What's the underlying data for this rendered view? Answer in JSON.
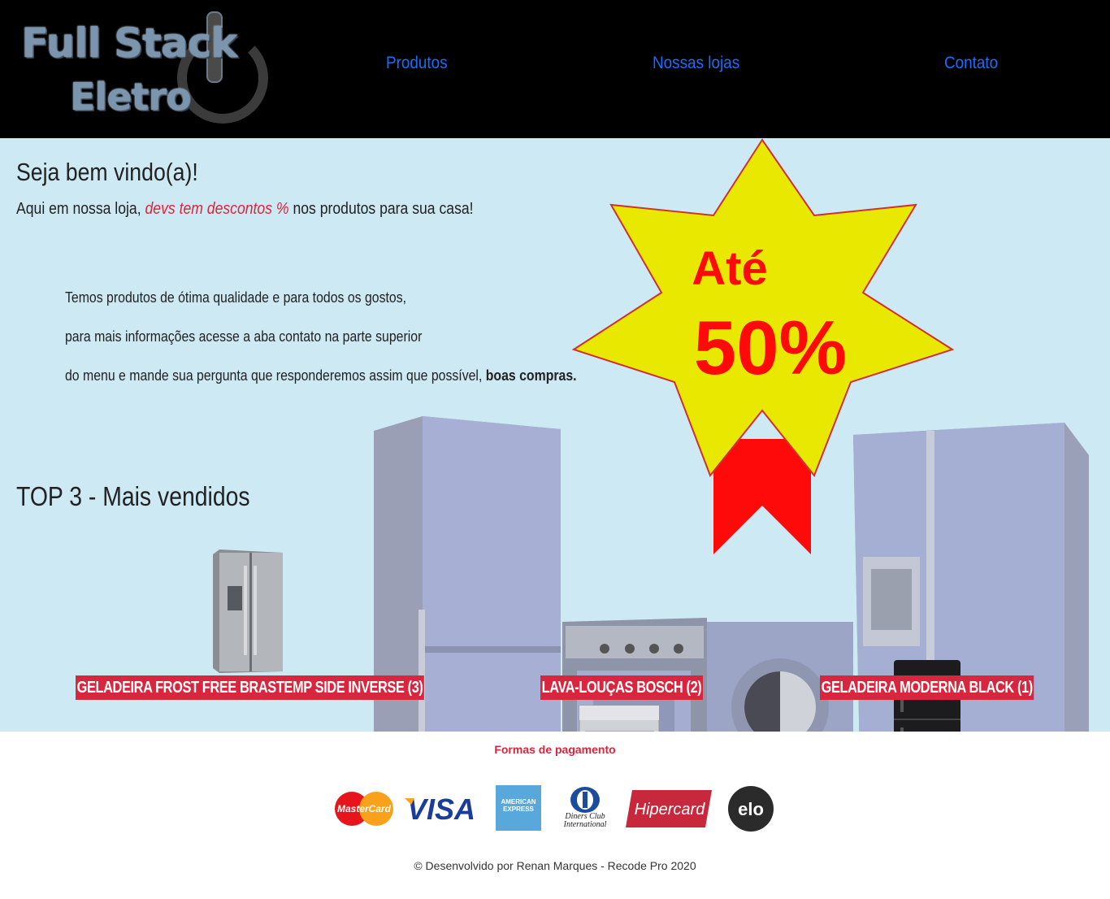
{
  "header": {
    "logo_line1": "Full Stack",
    "logo_line2": "Eletro",
    "nav": [
      "Produtos",
      "Nossas lojas",
      "Contato"
    ]
  },
  "hero": {
    "welcome": "Seja bem vindo(a)!",
    "intro_before": "Aqui em nossa loja, ",
    "intro_highlight": "devs tem descontos %",
    "intro_after": " nos produtos para sua casa!",
    "desc_line1": "Temos produtos de ótima qualidade e para todos os gostos,",
    "desc_line2": "para mais informações acesse a aba contato na parte superior",
    "desc_line3": "do menu e mande sua pergunta que responderemos assim que possível, ",
    "desc_bold": "boas compras.",
    "badge_line1": "Até",
    "badge_line2": "50%"
  },
  "top3": {
    "title": "TOP 3 - Mais vendidos",
    "products": [
      "GELADEIRA FROST FREE BRASTEMP SIDE INVERSE (3)",
      "LAVA-LOUÇAS BOSCH (2)",
      "GELADEIRA MODERNA BLACK (1)"
    ]
  },
  "footer": {
    "payment_title": "Formas de pagamento",
    "cards": [
      "MasterCard",
      "VISA",
      "AMERICAN EXPRESS",
      "Diners Club International",
      "Hipercard",
      "elo"
    ],
    "copyright": "© Desenvolvido por Renan Marques - Recode Pro 2020"
  },
  "colors": {
    "header_bg": "#000000",
    "main_bg": "#cde9f3",
    "accent_red": "#d7263d",
    "nav_blue": "#1a6cff",
    "badge_yellow": "#e8e800"
  }
}
